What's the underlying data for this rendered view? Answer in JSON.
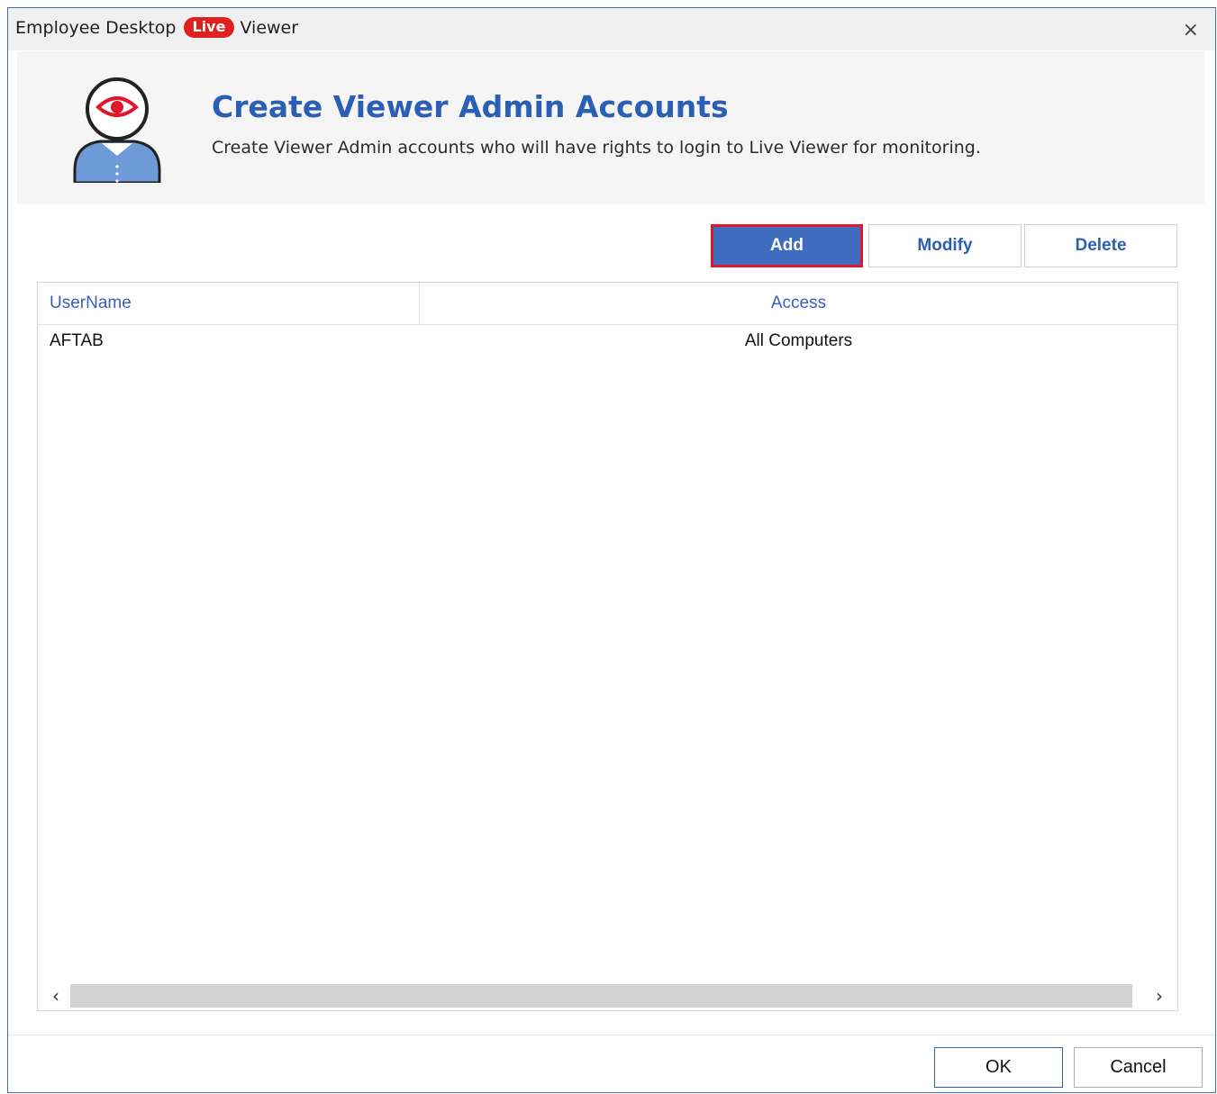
{
  "window": {
    "title_prefix": "Employee Desktop",
    "title_badge": "Live",
    "title_suffix": "Viewer",
    "close_glyph": "×"
  },
  "header": {
    "icon": "viewer-admin-icon",
    "title": "Create Viewer Admin Accounts",
    "subtitle": "Create Viewer Admin accounts who will have rights to login to Live Viewer for monitoring."
  },
  "toolbar": {
    "add_label": "Add",
    "modify_label": "Modify",
    "delete_label": "Delete"
  },
  "table": {
    "columns": [
      "UserName",
      "Access"
    ],
    "rows": [
      {
        "username": "AFTAB",
        "access": "All Computers"
      }
    ]
  },
  "scrollbar": {
    "left_glyph": "‹",
    "right_glyph": "›"
  },
  "footer": {
    "ok_label": "OK",
    "cancel_label": "Cancel"
  },
  "colors": {
    "accent": "#2b5fb5",
    "badge": "#e02020",
    "add_button_bg": "#3f6cbf",
    "add_button_border": "#e0162b"
  }
}
